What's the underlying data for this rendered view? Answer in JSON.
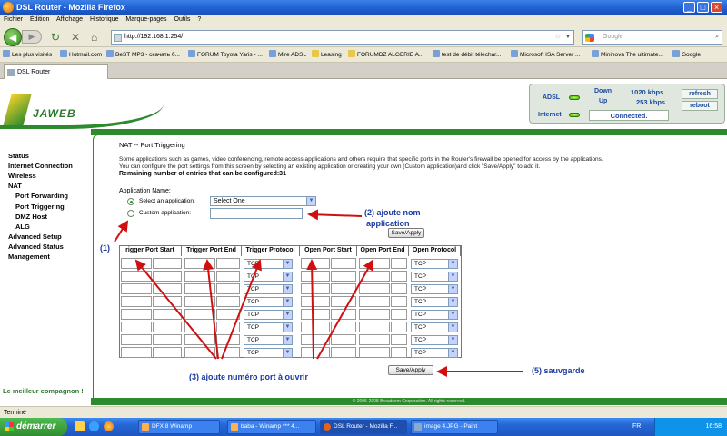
{
  "window": {
    "title": "DSL Router - Mozilla Firefox"
  },
  "menu": [
    "Fichier",
    "Édition",
    "Affichage",
    "Historique",
    "Marque-pages",
    "Outils",
    "?"
  ],
  "nav": {
    "url": "http://192.168.1.254/",
    "search_placeholder": "Google"
  },
  "bookmarks": [
    "Les plus visités",
    "Hotmail.com",
    "BeST MP3 - скачать б...",
    "FORUM Toyota Yaris - ...",
    "Mire ADSL",
    "Leasing",
    "FORUMDZ ALGERIE A...",
    "test de débit télechar...",
    "Microsoft ISA Server ...",
    "Mininova  The ultimate...",
    "Google"
  ],
  "tab": {
    "title": "DSL Router"
  },
  "logo": {
    "text": "JAWEB"
  },
  "status": {
    "adsl_label": "ADSL",
    "internet_label": "Internet",
    "down_label": "Down",
    "up_label": "Up",
    "down_value": "1020 kbps",
    "up_value": "253 kbps",
    "connection": "Connected.",
    "refresh": "refresh",
    "reboot": "reboot"
  },
  "sidebar": {
    "items": [
      {
        "label": "Status",
        "sub": false
      },
      {
        "label": "Internet Connection",
        "sub": false
      },
      {
        "label": "Wireless",
        "sub": false
      },
      {
        "label": "NAT",
        "sub": false
      },
      {
        "label": "Port Forwarding",
        "sub": true
      },
      {
        "label": "Port Triggering",
        "sub": true
      },
      {
        "label": "DMZ Host",
        "sub": true
      },
      {
        "label": "ALG",
        "sub": true
      },
      {
        "label": "Advanced Setup",
        "sub": false
      },
      {
        "label": "Advanced Status",
        "sub": false
      },
      {
        "label": "Management",
        "sub": false
      }
    ],
    "slogan": "Le meilleur compagnon !"
  },
  "page": {
    "title": "NAT -- Port Triggering",
    "desc1": "Some applications such as games, video conferencing, remote access applications and others require that specific ports in the Router's firewall be opened for access by the applications.",
    "desc2": "You can configure the port settings from this screen by selecting an existing application or creating your own (Custom application)and click \"Save/Apply\" to add it.",
    "remaining": "Remaining number of entries that can be configured:31",
    "app_name_label": "Application Name:",
    "select_label": "Select an application:",
    "select_value": "Select One",
    "custom_label": "Custom application:",
    "save_top": "Save/Apply",
    "save_bottom": "Save/Apply",
    "columns": [
      "rigger Port Start",
      "Trigger Port End",
      "Trigger Protocol",
      "Open Port Start",
      "Open Port End",
      "Open Protocol"
    ],
    "protocol_value": "TCP",
    "rows": 8
  },
  "annotations": {
    "a1": "(1)",
    "a2_line1": "(2) ajoute nom",
    "a2_line2": "application",
    "a3": "(3) ajoute numéro port à ouvrir",
    "a5": "(5) sauvgarde"
  },
  "footer": "© 2005-2008 Broadcom Corporation. All rights reserved.",
  "statusbar": "Terminé",
  "taskbar": {
    "start": "démarrer",
    "tasks": [
      "DFX 8 Winamp",
      "baba - Winamp *** 4...",
      "DSL Router - Mozilla F...",
      "image 4.JPG - Paint"
    ],
    "lang": "FR",
    "clock": "16:58"
  },
  "colors": {
    "accent_green": "#2d8a2d",
    "annotation_red": "#d01010",
    "annotation_blue": "#1a3aa0"
  }
}
